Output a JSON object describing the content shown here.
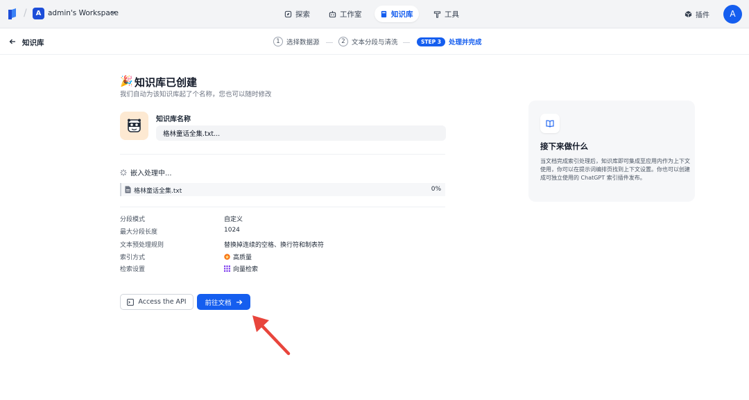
{
  "workspace": {
    "initial": "A",
    "name": "admin's Workspace"
  },
  "nav": {
    "explore": "探索",
    "studio": "工作室",
    "dataset": "知识库",
    "tools": "工具",
    "plugins": "插件",
    "user_initial": "A"
  },
  "subheader": {
    "back_label": "知识库",
    "steps": [
      {
        "num": "1",
        "label": "选择数据源"
      },
      {
        "num": "2",
        "label": "文本分段与清洗"
      },
      {
        "badge": "STEP 3",
        "label": "处理并完成"
      }
    ]
  },
  "main": {
    "title_emoji": "🎉",
    "title": "知识库已创建",
    "subtitle": "我们自动为该知识库起了个名称，您也可以随时修改",
    "kb_name_label": "知识库名称",
    "kb_name_value": "格林童话全集.txt...",
    "embed_status": "嵌入处理中...",
    "file": {
      "name": "格林童话全集.txt",
      "progress": "0%"
    },
    "info": [
      {
        "label": "分段模式",
        "value": "自定义"
      },
      {
        "label": "最大分段长度",
        "value": "1024"
      },
      {
        "label": "文本预处理规则",
        "value": "替换掉连续的空格、换行符和制表符"
      },
      {
        "label": "索引方式",
        "value": "高质量",
        "icon": "high-quality-icon"
      },
      {
        "label": "检索设置",
        "value": "向量检索",
        "icon": "vector-search-icon"
      }
    ],
    "api_button": "Access the API",
    "go_button": "前往文档"
  },
  "next_panel": {
    "title": "接下来做什么",
    "description": "当文档完成索引处理后，知识库即可集成至应用内作为上下文使用，你可以在提示词编排页找到上下文设置。你也可以创建成可独立使用的 ChatGPT 索引插件发布。"
  },
  "colors": {
    "accent": "#155eef",
    "annotation_arrow": "#e8453c"
  }
}
